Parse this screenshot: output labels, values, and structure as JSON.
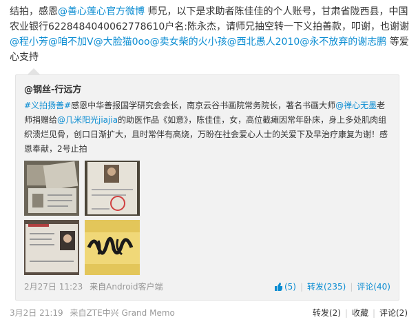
{
  "post": {
    "text_1": "结拍，感恩",
    "mention_1": "@善心莲心官方微博",
    "text_2": " 师兄，以下是求助者陈佳佳的个人账号，甘肃省陇西县，中国农业银行6228484040062778610户名:陈永杰，请师兄抽空转一下义拍善款，叩谢，也谢谢",
    "mention_2": "@程小芳",
    "mention_3": "@咱不加V",
    "mention_4": "@大脸猫0oo",
    "mention_5": "@卖女柴的火小孩",
    "mention_6": "@西北愚人2010",
    "mention_7": "@永不放弃的谢志鹏",
    "text_3": " 等爱心支持",
    "time": "3月2日 21:19",
    "source_prefix": "来自",
    "source": "ZTE中兴 Grand Memo",
    "forward": "转发(2)",
    "favorite": "收藏",
    "comment": "评论(2)"
  },
  "quoted": {
    "author": "@钢丝-行远方",
    "hashtag": "#义拍扬善#",
    "text_1": "感恩中华善报国学研究会会长，南京云谷书画院常务院长，著名书画大师",
    "mention_1": "@禅心无墨",
    "text_2": "老师捐赠给",
    "mention_2": "@几米阳光jiajia",
    "text_3": "的助医作品《如意》，陈佳佳，女，高位截瘫因常年卧床，身上多处肌肉组织溃烂见骨，创口日渐扩大，且时常伴有高烧，万盼在社会爱心人士的关爱下及早治疗康复为谢！感恩奉献，2号止拍",
    "time": "2月27日 11:23",
    "source_prefix": "来自",
    "source": "Android客户端",
    "like": "(5)",
    "forward": "转发(235)",
    "comment": "评论(40)"
  },
  "images": [
    {
      "icon": "certificate-photo"
    },
    {
      "icon": "id-document-photo"
    },
    {
      "icon": "id-card-photo"
    },
    {
      "icon": "calligraphy-photo"
    }
  ],
  "colors": {
    "link": "#0a8cd2",
    "quote_bg": "#f2f2f2"
  }
}
